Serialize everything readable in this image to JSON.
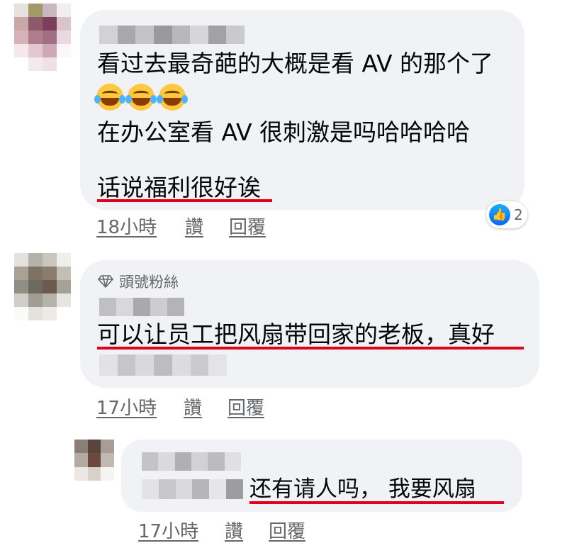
{
  "comments": [
    {
      "text_lines": [
        "看过去最奇葩的大概是看 AV 的那个了",
        "在办公室看 AV 很刺激是吗哈哈哈哈",
        "话说福利很好诶"
      ],
      "emoji": "face-with-tears-of-joy x3",
      "timestamp": "18小時",
      "like_label": "讚",
      "reply_label": "回覆",
      "reaction_count": "2",
      "reaction_icon": "like-icon"
    },
    {
      "badge_label": "頭號粉絲",
      "badge_icon": "diamond-icon",
      "text": "可以让员工把风扇带回家的老板，真好",
      "timestamp": "17小時",
      "like_label": "讚",
      "reply_label": "回覆"
    },
    {
      "text": "还有请人吗， 我要风扇",
      "timestamp": "17小時",
      "like_label": "讚",
      "reply_label": "回覆"
    }
  ],
  "colors": {
    "bubble": "#f0f2f5",
    "meta_text": "#65676b",
    "highlight_underline": "#e0001b",
    "like_blue": "#0866ff"
  }
}
